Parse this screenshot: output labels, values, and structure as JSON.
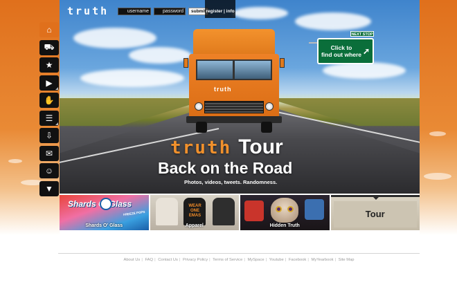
{
  "header": {
    "logo_text": "truth",
    "username_placeholder": "username",
    "password_placeholder": "password",
    "submit_label": "submit",
    "register_label": "register | info"
  },
  "nav": {
    "items": [
      {
        "icon": "home-icon",
        "glyph": "⌂",
        "active": true
      },
      {
        "icon": "truck-icon",
        "glyph": "⛟"
      },
      {
        "icon": "star-icon",
        "glyph": "★"
      },
      {
        "icon": "play-icon",
        "glyph": "▶"
      },
      {
        "icon": "thumbs-up-icon",
        "glyph": "✋"
      },
      {
        "icon": "list-icon",
        "glyph": "☰"
      },
      {
        "icon": "down-arrow-icon",
        "glyph": "⇩"
      },
      {
        "icon": "briefcase-icon",
        "glyph": "✉"
      },
      {
        "icon": "people-icon",
        "glyph": "☺"
      },
      {
        "icon": "shirt-icon",
        "glyph": "▼"
      }
    ]
  },
  "hero": {
    "truck_logo": "truth",
    "sign_tag": "NEXT STOP",
    "sign_line1": "Click to",
    "sign_line2": "find out where",
    "title_brand": "truth",
    "title_word": "Tour",
    "title_line2": "Back on the Road",
    "subtitle": "Photos, videos, tweets. Randomness."
  },
  "thumbnails": [
    {
      "label": "Shards O' Glass",
      "art": "Shards O' Glass",
      "small": "FREEZE POPS"
    },
    {
      "label": "Apparel",
      "shirt_text": "WEAR ONE EMAS"
    },
    {
      "label": "Hidden Truth"
    },
    {
      "label": "Tour"
    }
  ],
  "footer": {
    "links": [
      "About Us",
      "FAQ",
      "Contact Us",
      "Privacy Policy",
      "Terms of Service",
      "MySpace",
      "Youtube",
      "Facebook",
      "MyYearbook",
      "Site Map"
    ]
  },
  "colors": {
    "accent": "#e0701c",
    "sign_green": "#0a6e3a"
  }
}
